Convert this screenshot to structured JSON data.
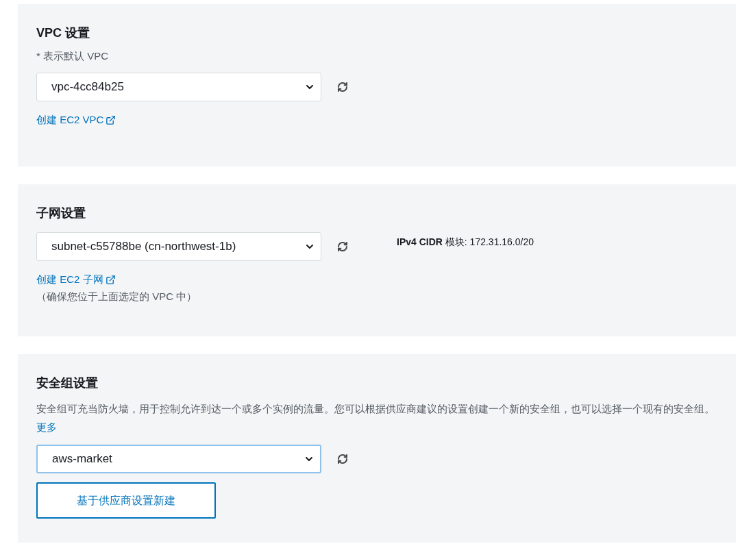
{
  "sections": [
    {
      "title": "VPC 设置",
      "note": "* 表示默认 VPC",
      "select": {
        "value": "vpc-4cc84b25",
        "focused": false
      },
      "link": "创建 EC2 VPC"
    },
    {
      "title": "子网设置",
      "select": {
        "value": "subnet-c55788be (cn-northwest-1b)",
        "focused": false
      },
      "info": "**IPv4 CIDR** 模块: 172.31.16.0/20",
      "link": "创建 EC2 子网",
      "hint": "（确保您位于上面选定的 VPC 中）"
    },
    {
      "title": "安全组设置",
      "description": {
        "text": "安全组可充当防火墙，用于控制允许到达一个或多个实例的流量。您可以根据供应商建议的设置创建一个新的安全组，也可以选择一个现有的安全组。",
        "link": "更多"
      },
      "select": {
        "value": "aws-market",
        "focused": true
      },
      "button": "基于供应商设置新建"
    }
  ]
}
